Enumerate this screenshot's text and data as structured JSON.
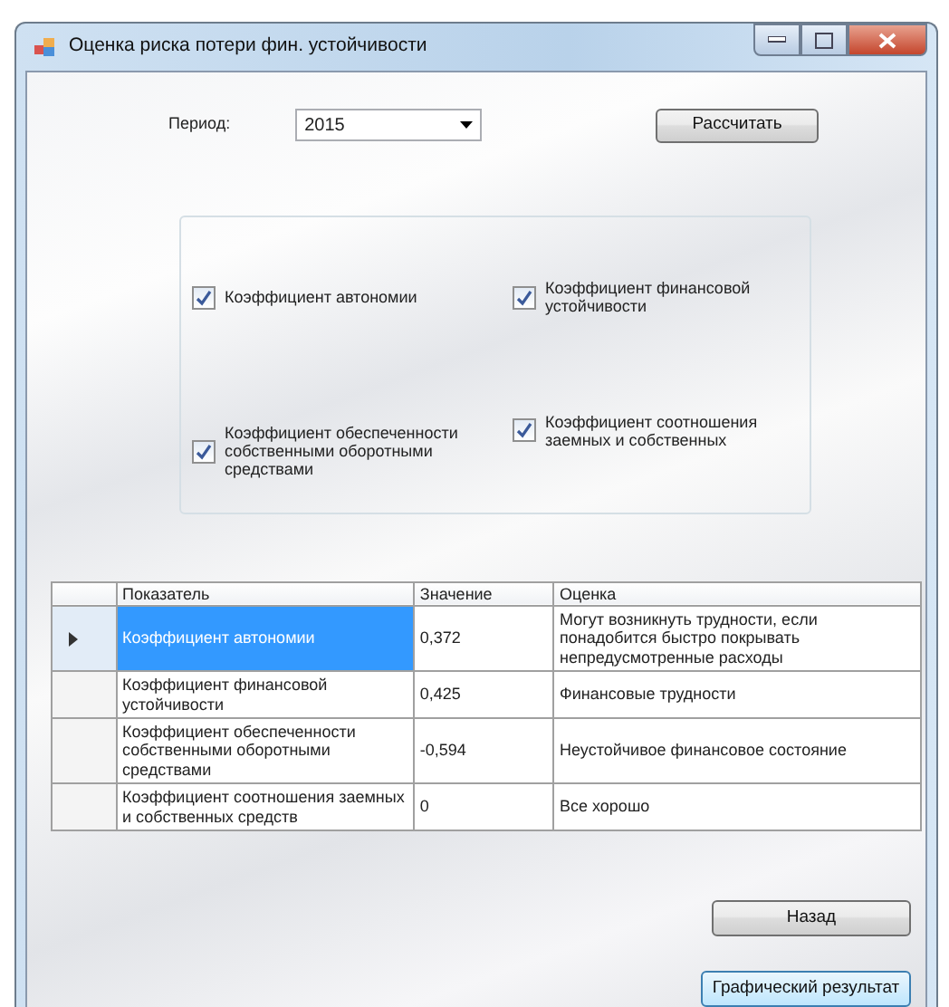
{
  "window": {
    "title": "Оценка риска потери фин. устойчивости"
  },
  "period": {
    "label": "Период:",
    "value": "2015"
  },
  "calculate_button": "Рассчитать",
  "indicators": [
    {
      "label": "Коэффициент автономии",
      "checked": true
    },
    {
      "label": "Коэффициент финансовой устойчивости",
      "checked": true
    },
    {
      "label": "Коэффициент обеспеченности собственными оборотными средствами",
      "checked": true
    },
    {
      "label": "Коэффициент соотношения заемных и собственных",
      "checked": true
    }
  ],
  "table": {
    "columns": [
      "Показатель",
      "Значение",
      "Оценка"
    ],
    "rows": [
      {
        "selected": true,
        "cells": [
          "Коэффициент автономии",
          "0,372",
          "Могут возникнуть трудности, если понадобится быстро покрывать непредусмотренные расходы"
        ]
      },
      {
        "selected": false,
        "cells": [
          "Коэффициент финансовой устойчивости",
          "0,425",
          "Финансовые трудности"
        ]
      },
      {
        "selected": false,
        "cells": [
          "Коэффициент обеспеченности собственными оборотными средствами",
          "-0,594",
          "Неустойчивое финансовое состояние"
        ]
      },
      {
        "selected": false,
        "cells": [
          "Коэффициент соотношения заемных и собственных средств",
          "0",
          "Все хорошо"
        ]
      }
    ]
  },
  "buttons": [
    "Назад",
    "Графический результат"
  ]
}
